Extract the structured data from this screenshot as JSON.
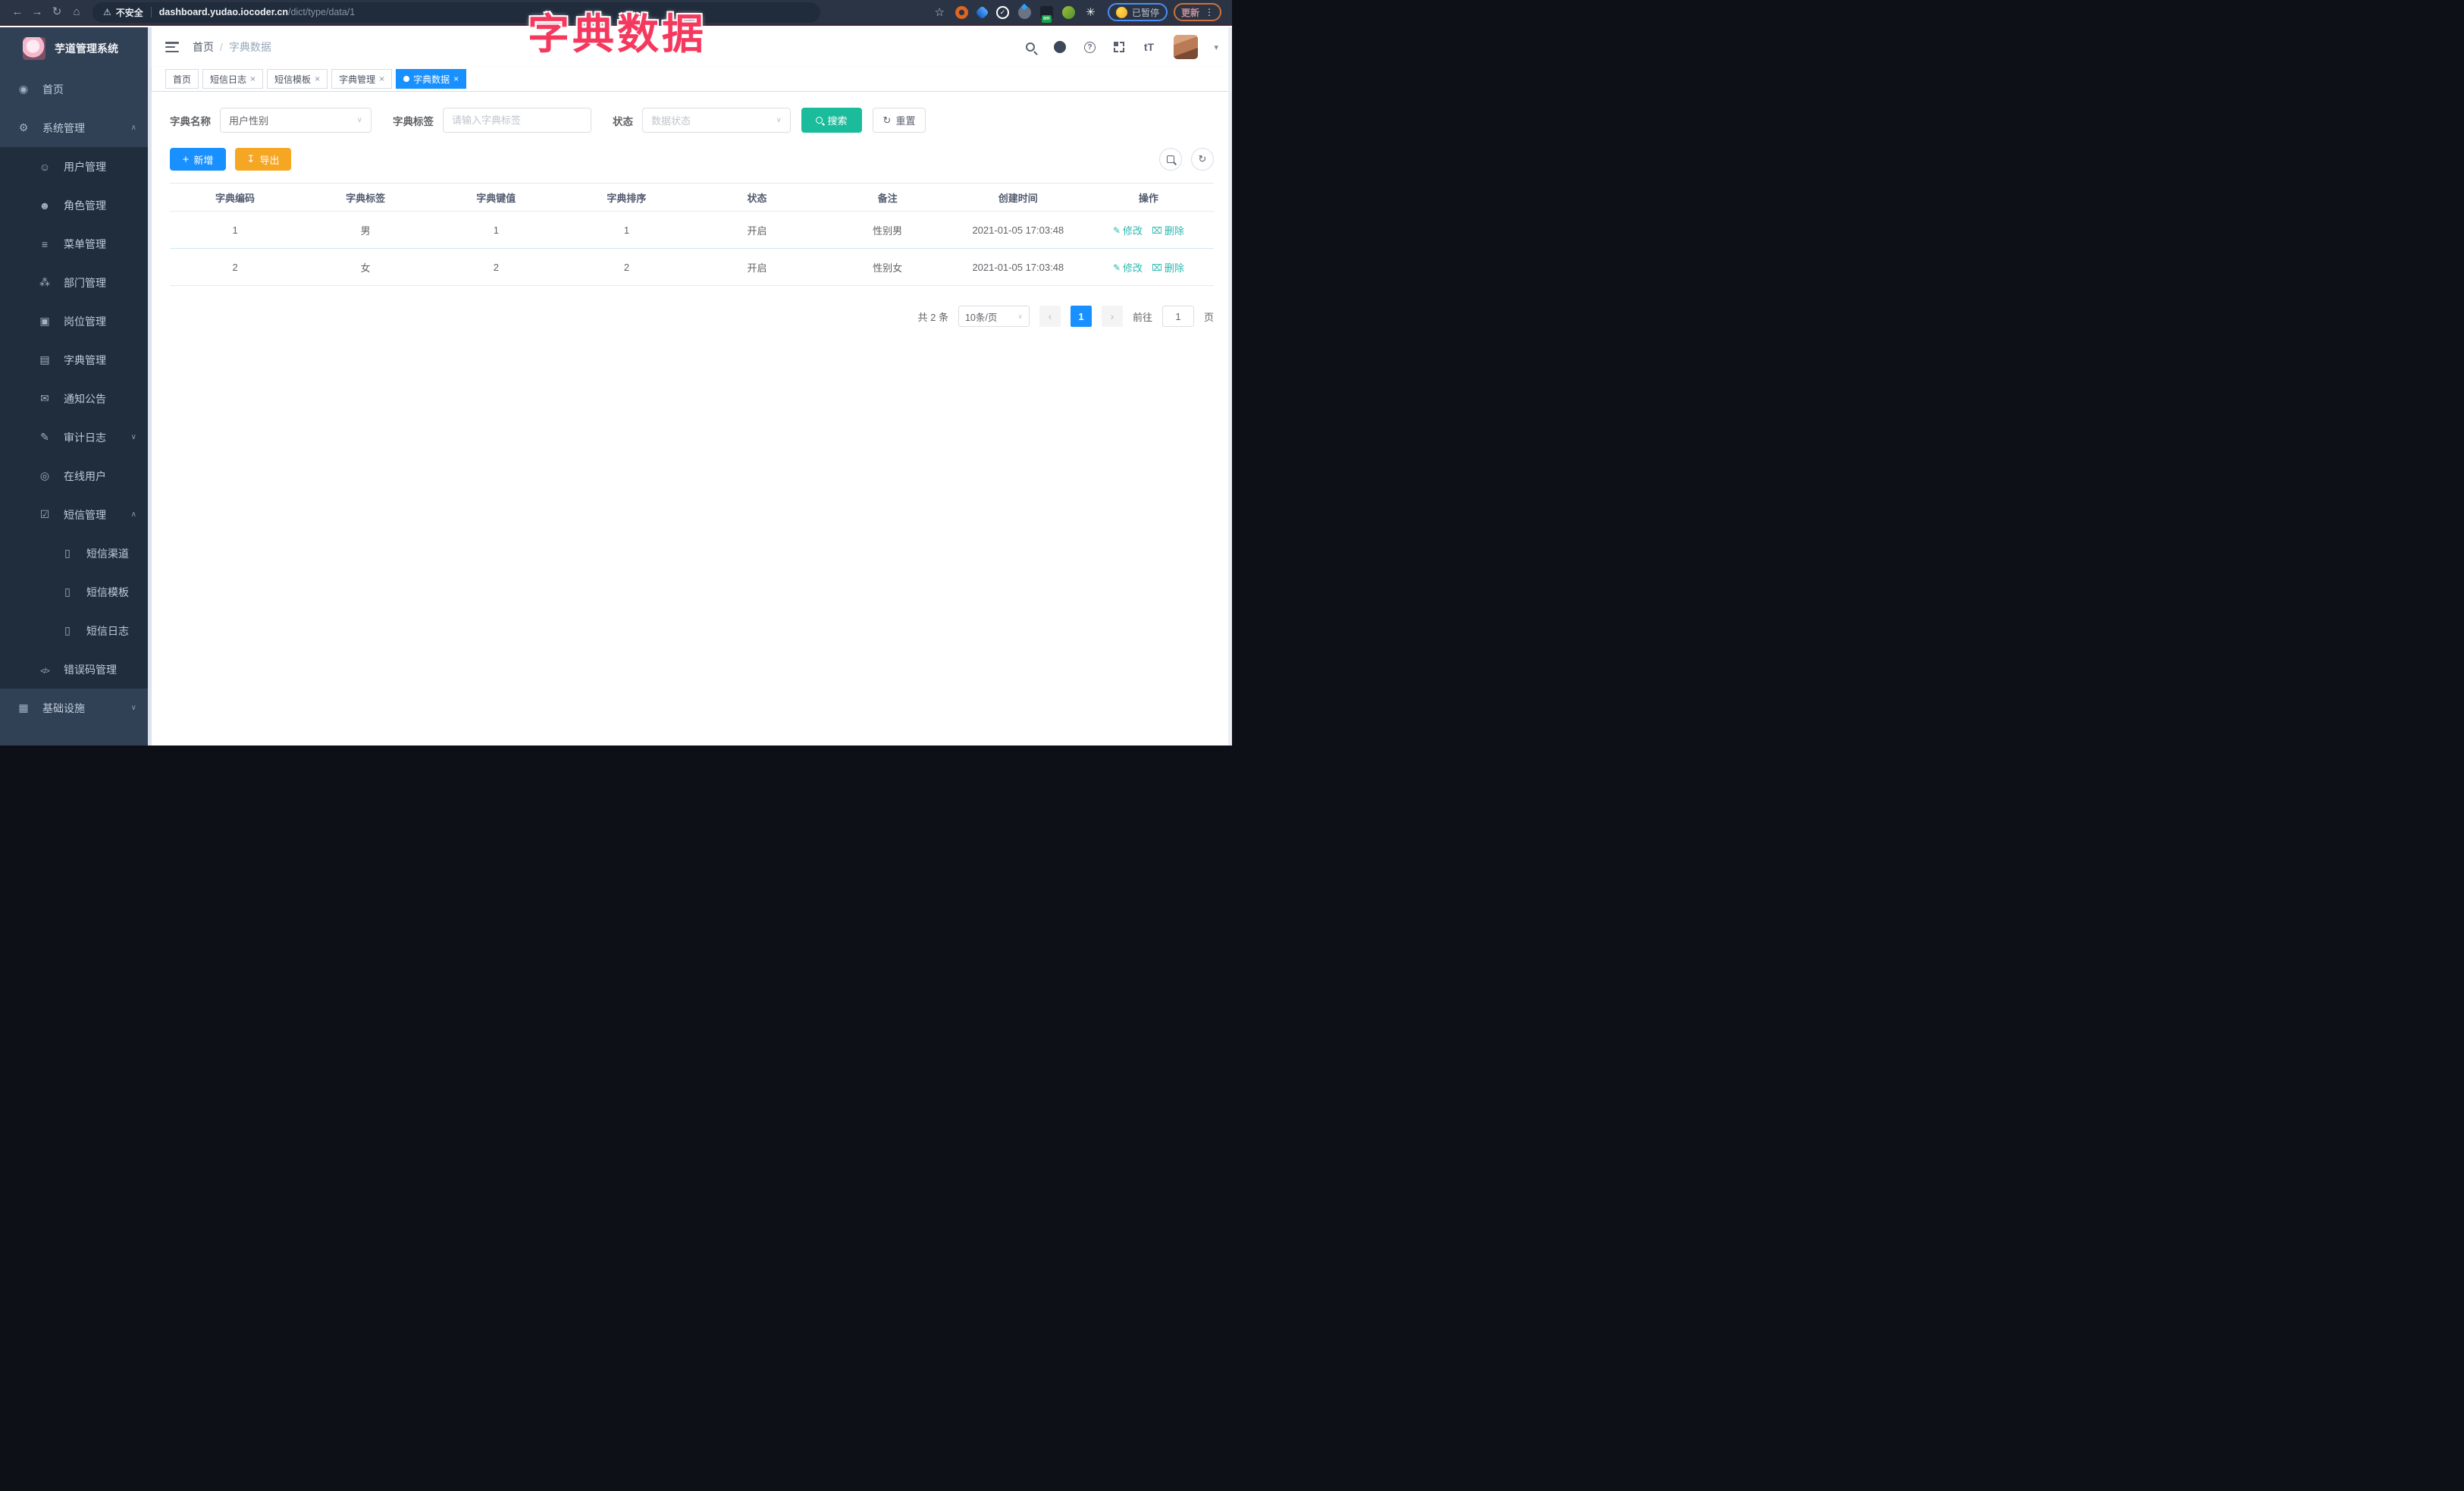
{
  "browser": {
    "security_label": "不安全",
    "url_host": "dashboard.yudao.iocoder.cn",
    "url_path": "/dict/type/data/1",
    "extension_on_badge": "on",
    "paused_label": "已暂停",
    "update_label": "更新"
  },
  "overlay_title": "字典数据",
  "sidebar": {
    "app_title": "芋道管理系统",
    "items": [
      {
        "label": "首页"
      },
      {
        "label": "系统管理"
      },
      {
        "label": "用户管理"
      },
      {
        "label": "角色管理"
      },
      {
        "label": "菜单管理"
      },
      {
        "label": "部门管理"
      },
      {
        "label": "岗位管理"
      },
      {
        "label": "字典管理"
      },
      {
        "label": "通知公告"
      },
      {
        "label": "审计日志"
      },
      {
        "label": "在线用户"
      },
      {
        "label": "短信管理"
      },
      {
        "label": "短信渠道"
      },
      {
        "label": "短信模板"
      },
      {
        "label": "短信日志"
      },
      {
        "label": "错误码管理"
      },
      {
        "label": "基础设施"
      }
    ]
  },
  "breadcrumb": {
    "home": "首页",
    "current": "字典数据"
  },
  "tabs": [
    {
      "label": "首页"
    },
    {
      "label": "短信日志"
    },
    {
      "label": "短信模板"
    },
    {
      "label": "字典管理"
    },
    {
      "label": "字典数据"
    }
  ],
  "filters": {
    "dict_name_label": "字典名称",
    "dict_name_value": "用户性别",
    "dict_label_label": "字典标签",
    "dict_label_placeholder": "请输入字典标签",
    "status_label": "状态",
    "status_placeholder": "数据状态",
    "search_label": "搜索",
    "reset_label": "重置"
  },
  "toolbar": {
    "add_label": "新增",
    "export_label": "导出"
  },
  "table": {
    "columns": [
      "字典编码",
      "字典标签",
      "字典键值",
      "字典排序",
      "状态",
      "备注",
      "创建时间",
      "操作"
    ],
    "rows": [
      {
        "code": "1",
        "label": "男",
        "value": "1",
        "sort": "1",
        "status": "开启",
        "remark": "性别男",
        "created": "2021-01-05 17:03:48"
      },
      {
        "code": "2",
        "label": "女",
        "value": "2",
        "sort": "2",
        "status": "开启",
        "remark": "性别女",
        "created": "2021-01-05 17:03:48"
      }
    ],
    "edit_label": "修改",
    "delete_label": "删除"
  },
  "pagination": {
    "total": "共 2 条",
    "page_size": "10条/页",
    "page": "1",
    "goto": "前往",
    "goto_value": "1",
    "unit": "页"
  },
  "colors": {
    "primary_blue": "#1890ff",
    "search_teal": "#1abc9c",
    "export_amber": "#f5a623",
    "link_teal": "#2ab7b0",
    "title_red": "#f5395e",
    "sidebar_bg": "#304156",
    "submenu_bg": "#1f2d3d"
  }
}
